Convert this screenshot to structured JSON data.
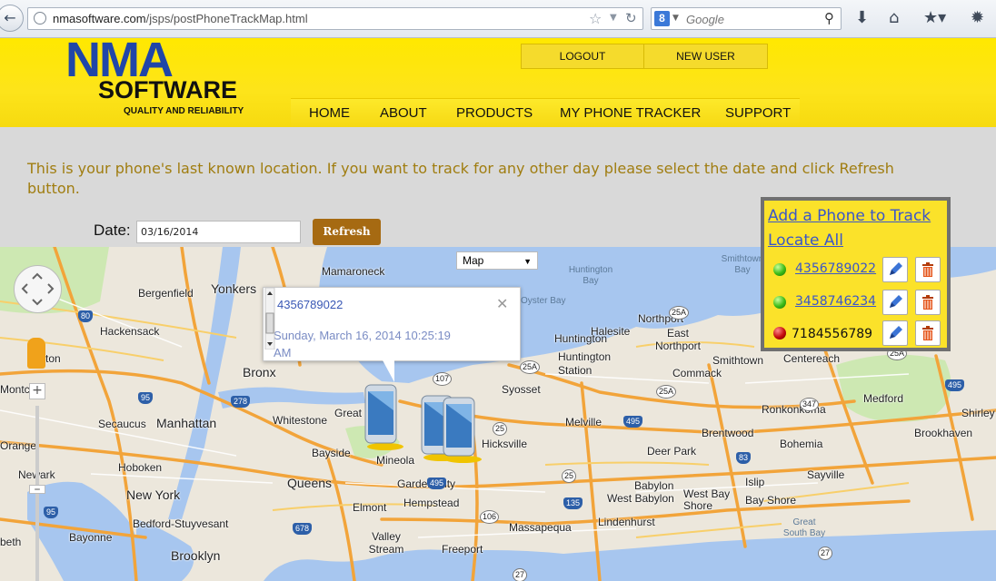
{
  "browser": {
    "url_host": "nmasoftware.com",
    "url_path": "/jsps/postPhoneTrackMap.html",
    "search_placeholder": "Google",
    "search_engine_badge": "8"
  },
  "header": {
    "logo_main": "NMA",
    "logo_sub": "SOFTWARE",
    "logo_tagline": "QUALITY AND RELIABILITY",
    "top_buttons": [
      "LOGOUT",
      "NEW USER"
    ],
    "nav": [
      "HOME",
      "ABOUT",
      "PRODUCTS",
      "MY PHONE TRACKER",
      "SUPPORT"
    ]
  },
  "content": {
    "intro": "This is your phone's last known location. If you want to track for any other day please select the date and click Refresh button.",
    "date_label": "Date:",
    "date_value": "03/16/2014",
    "refresh_label": "Refresh"
  },
  "map": {
    "type_selector": "Map",
    "info_window": {
      "phone": "4356789022",
      "timestamp": "Sunday, March 16, 2014 10:25:19 AM"
    },
    "labels": [
      "Yonkers",
      "Mamaroneck",
      "Bergenfield",
      "Hackensack",
      "Bronx",
      "Secaucus",
      "Manhattan",
      "Whitestone",
      "New York",
      "Hoboken",
      "Bayside",
      "Queens",
      "Newark",
      "Great Neck",
      "Mineola",
      "Garden City",
      "Hempstead",
      "Elmont",
      "Valley Stream",
      "Freeport",
      "Massapequa",
      "Lindenhurst",
      "Hicksville",
      "Syosset",
      "Melville",
      "Deer Park",
      "Brentwood",
      "Islip",
      "West Babylon",
      "Babylon",
      "West Bay Shore",
      "Bay Shore",
      "Huntington Station",
      "Huntington",
      "East Northport",
      "Northport",
      "Halesite",
      "Commack",
      "Smithtown",
      "Centereach",
      "Ronkonkoma",
      "Bohemia",
      "Sayville",
      "Medford",
      "Brookhaven",
      "Shirley",
      "Bedford-Stuyvesant",
      "Bayonne",
      "Brooklyn",
      "Great South Bay",
      "Huntington Bay",
      "Oyster Bay",
      "Smithtown Bay",
      "Orange",
      "Montclair",
      "ton",
      "beth"
    ],
    "water_labels": [
      "Huntington Bay",
      "Oyster Bay",
      "Smithtown Bay",
      "Great South Bay"
    ],
    "highways": [
      "95",
      "278",
      "495",
      "495",
      "25A",
      "107",
      "25A",
      "25",
      "25",
      "25A",
      "27",
      "106",
      "678",
      "95",
      "80",
      "135",
      "495",
      "27",
      "25A",
      "83",
      "347"
    ]
  },
  "tracker": {
    "add_link": "Add a Phone to Track",
    "locate_all": "Locate All",
    "phones": [
      {
        "number": "4356789022",
        "status": "green",
        "linked": true
      },
      {
        "number": "3458746234",
        "status": "green",
        "linked": true
      },
      {
        "number": "7184556789",
        "status": "red",
        "linked": false
      }
    ]
  }
}
